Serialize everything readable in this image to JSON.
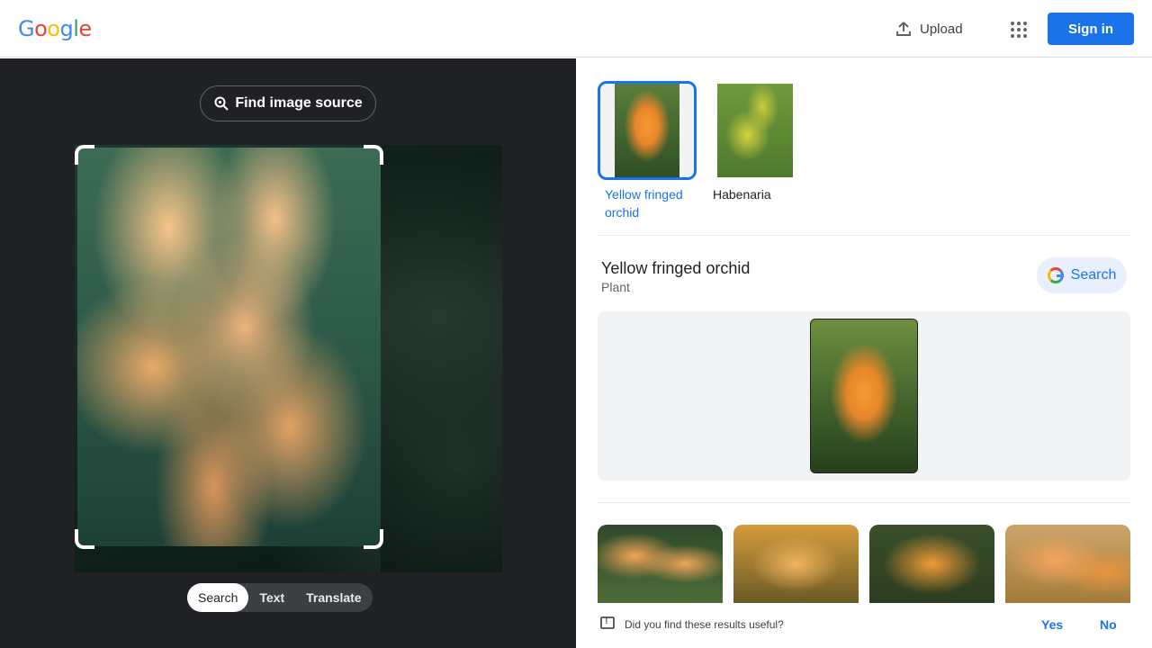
{
  "header": {
    "logo_letters": [
      "G",
      "o",
      "o",
      "g",
      "l",
      "e"
    ],
    "logo_colors": [
      "#4285f4",
      "#ea4335",
      "#fbbc05",
      "#4285f4",
      "#34a853",
      "#ea4335"
    ],
    "upload_label": "Upload",
    "signin_label": "Sign in"
  },
  "left_panel": {
    "find_source_label": "Find image source",
    "modes": [
      "Search",
      "Text",
      "Translate"
    ],
    "active_mode": "Search"
  },
  "results": {
    "chips": [
      {
        "label": "Yellow fringed orchid",
        "selected": true
      },
      {
        "label": "Habenaria",
        "selected": false
      }
    ],
    "knowledge_panel": {
      "title": "Yellow fringed orchid",
      "subtitle": "Plant",
      "search_label": "Search"
    },
    "feedback": {
      "question": "Did you find these results useful?",
      "yes_label": "Yes",
      "no_label": "No"
    }
  },
  "colors": {
    "accent": "#1a73e8",
    "dark_panel": "#202124"
  }
}
